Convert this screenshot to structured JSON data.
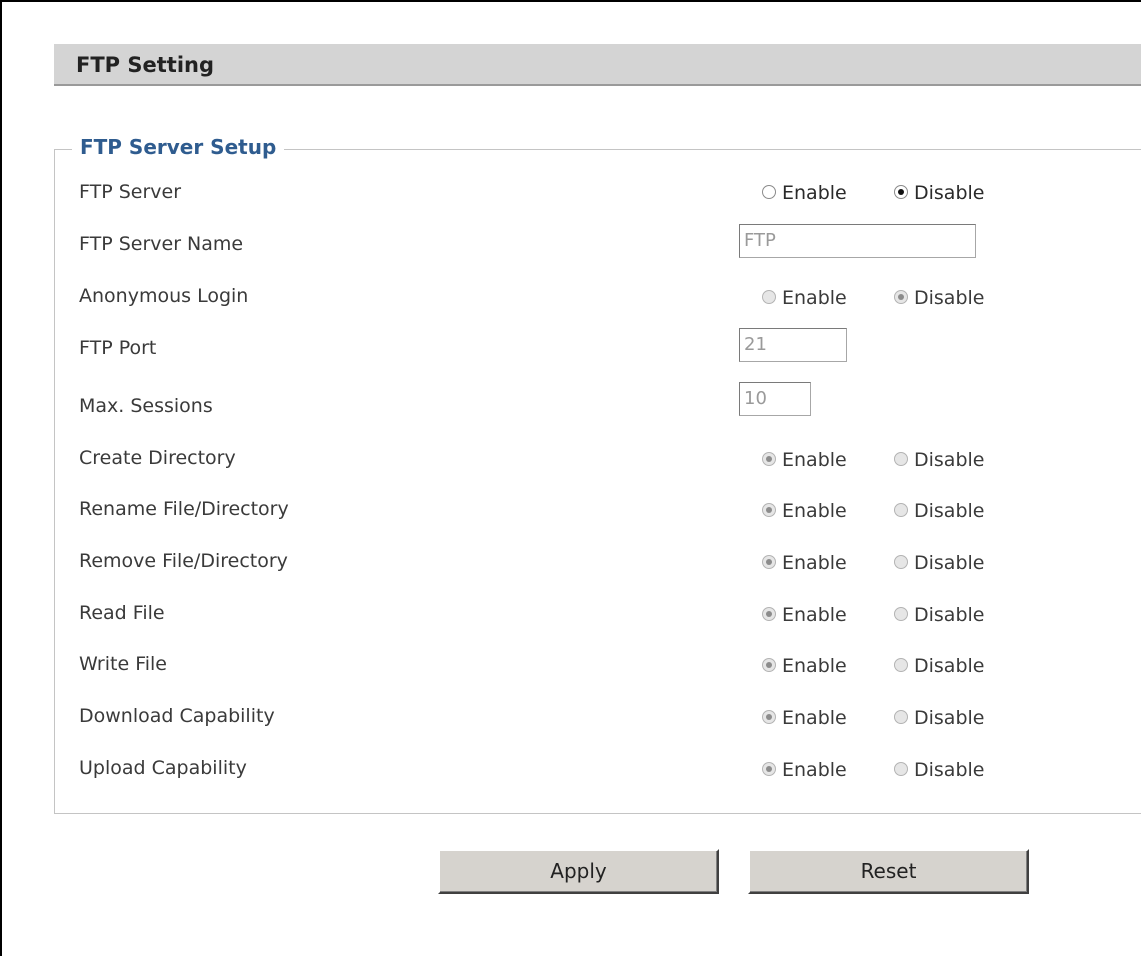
{
  "header": {
    "title": "FTP Setting"
  },
  "section": {
    "title": "FTP Server Setup"
  },
  "labels": {
    "enable": "Enable",
    "disable": "Disable"
  },
  "rows": {
    "ftp_server": {
      "label": "FTP Server",
      "selected": "Disable",
      "disabled": false
    },
    "ftp_server_name": {
      "label": "FTP Server Name",
      "value": "FTP"
    },
    "anonymous_login": {
      "label": "Anonymous Login",
      "selected": "Disable",
      "disabled": true
    },
    "ftp_port": {
      "label": "FTP Port",
      "value": "21"
    },
    "max_sessions": {
      "label": "Max. Sessions",
      "value": "10"
    },
    "create_directory": {
      "label": "Create Directory",
      "selected": "Enable",
      "disabled": true
    },
    "rename_file_directory": {
      "label": "Rename File/Directory",
      "selected": "Enable",
      "disabled": true
    },
    "remove_file_directory": {
      "label": "Remove File/Directory",
      "selected": "Enable",
      "disabled": true
    },
    "read_file": {
      "label": "Read File",
      "selected": "Enable",
      "disabled": true
    },
    "write_file": {
      "label": "Write File",
      "selected": "Enable",
      "disabled": true
    },
    "download_capability": {
      "label": "Download Capability",
      "selected": "Enable",
      "disabled": true
    },
    "upload_capability": {
      "label": "Upload Capability",
      "selected": "Enable",
      "disabled": true
    }
  },
  "buttons": {
    "apply": "Apply",
    "reset": "Reset"
  }
}
